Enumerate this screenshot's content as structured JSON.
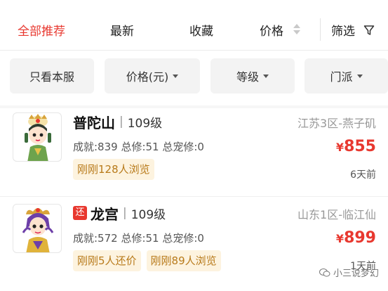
{
  "sort_tabs": {
    "recommended": "全部推荐",
    "latest": "最新",
    "favorites": "收藏",
    "price": "价格",
    "filter": "筛选"
  },
  "filter_chips": {
    "same_server": "只看本服",
    "price": "价格(元)",
    "level": "等级",
    "school": "门派"
  },
  "listings": [
    {
      "name": "普陀山",
      "level": "109级",
      "server": "江苏3区-燕子矶",
      "stats": "成就:839 总修:51 总宠修:0",
      "currency": "¥",
      "price": "855",
      "badges": [
        "刚刚128人浏览"
      ],
      "time": "6天前"
    },
    {
      "tag": "还",
      "name": "龙宫",
      "level": "109级",
      "server": "山东1区-临江仙",
      "stats": "成就:572 总修:51 总宠修:0",
      "currency": "¥",
      "price": "899",
      "badges": [
        "刚刚5人还价",
        "刚刚89人浏览"
      ],
      "time": "1天前"
    }
  ],
  "watermark": "小三说梦幻",
  "colors": {
    "accent": "#e8382f",
    "badge_bg": "#fdf3df",
    "badge_text": "#b87a1a"
  }
}
